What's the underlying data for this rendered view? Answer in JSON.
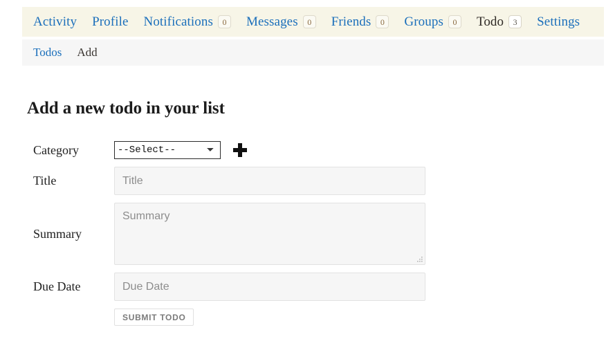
{
  "primary_nav": {
    "items": [
      {
        "label": "Activity",
        "badge": null,
        "current": false
      },
      {
        "label": "Profile",
        "badge": null,
        "current": false
      },
      {
        "label": "Notifications",
        "badge": "0",
        "current": false
      },
      {
        "label": "Messages",
        "badge": "0",
        "current": false
      },
      {
        "label": "Friends",
        "badge": "0",
        "current": false
      },
      {
        "label": "Groups",
        "badge": "0",
        "current": false
      },
      {
        "label": "Todo",
        "badge": "3",
        "current": true
      },
      {
        "label": "Settings",
        "badge": null,
        "current": false
      }
    ]
  },
  "secondary_nav": {
    "items": [
      {
        "label": "Todos",
        "current": false
      },
      {
        "label": "Add",
        "current": true
      }
    ]
  },
  "main": {
    "title": "Add a new todo in your list",
    "form": {
      "category": {
        "label": "Category",
        "selected_option": "--Select--",
        "options": [
          "--Select--"
        ],
        "add_icon": "plus-icon"
      },
      "title": {
        "label": "Title",
        "value": "",
        "placeholder": "Title"
      },
      "summary": {
        "label": "Summary",
        "value": "",
        "placeholder": "Summary"
      },
      "due_date": {
        "label": "Due Date",
        "value": "",
        "placeholder": "Due Date"
      },
      "submit_label": "SUBMIT TODO"
    }
  },
  "colors": {
    "primary_nav_bg": "#f7f5e7",
    "secondary_nav_bg": "#f6f6f6",
    "link": "#1b6fbb",
    "active_text": "#2f2a26",
    "input_bg": "#f6f6f6",
    "input_border": "#e2e2e2",
    "placeholder": "#8d8d8d",
    "submit_text": "#7b7b7b"
  }
}
